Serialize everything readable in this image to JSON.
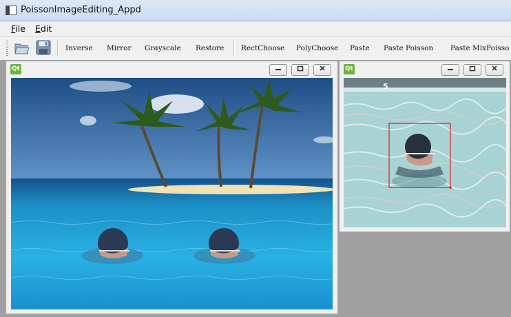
{
  "window": {
    "title": "PoissonImageEditing_Appd"
  },
  "menu": {
    "file": "F",
    "file_rest": "ile",
    "edit": "E",
    "edit_rest": "dit"
  },
  "toolbar": {
    "open_icon": "folder-open-icon",
    "save_icon": "floppy-save-icon",
    "buttons": [
      "Inverse",
      "Mirror",
      "Grayscale",
      "Restore",
      "RectChoose",
      "PolyChoose",
      "Paste",
      "Paste Poisson",
      "Paste MixPoisso"
    ]
  },
  "subwindows": {
    "badge": "Qt",
    "minimize": "minimize-icon",
    "restore": "restore-icon",
    "close": "close-icon",
    "target_image_content": "tropical island with three palm trees, sea and two pasted swimmer heads",
    "source_image_content": "swimmer in pool with red rectangle selection",
    "lane_marker": "5"
  },
  "colors": {
    "selection_rect": "#e01a1a",
    "qt_green": "#6cb33f",
    "mdi_background": "#a0a0a0"
  }
}
